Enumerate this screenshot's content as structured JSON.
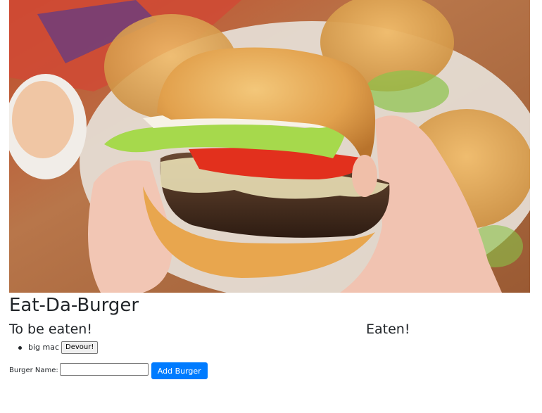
{
  "hero": {
    "image": "burger-photo"
  },
  "page": {
    "title": "Eat-Da-Burger"
  },
  "columns": {
    "to_eat_heading": "To be eaten!",
    "eaten_heading": "Eaten!"
  },
  "to_eat": [
    {
      "name": "big mac",
      "action_label": "Devour!"
    }
  ],
  "eaten": [],
  "form": {
    "label": "Burger Name:",
    "input_value": "",
    "submit_label": "Add Burger"
  },
  "colors": {
    "primary_button": "#007bff",
    "text": "#212529"
  }
}
